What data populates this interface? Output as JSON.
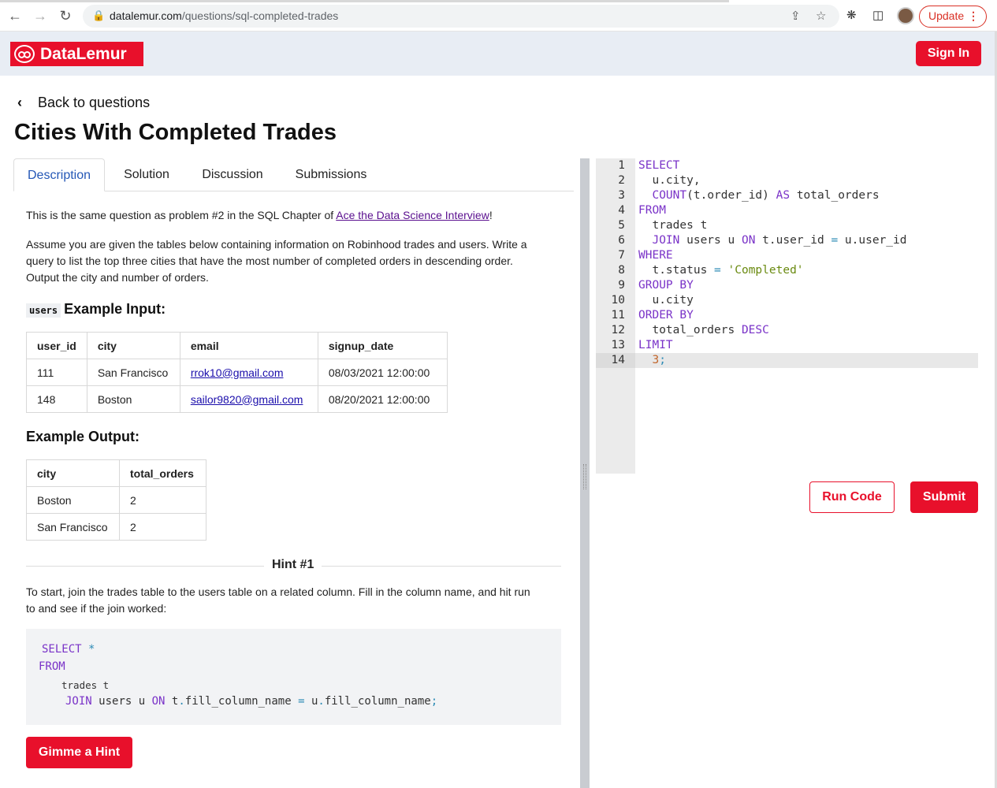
{
  "browser": {
    "url_domain": "datalemur.com",
    "url_path": "/questions/sql-completed-trades",
    "update_label": "Update"
  },
  "header": {
    "logo_text": "DataLemur",
    "signin_label": "Sign In"
  },
  "page": {
    "back_label": "Back to questions",
    "title": "Cities With Completed Trades"
  },
  "tabs": [
    "Description",
    "Solution",
    "Discussion",
    "Submissions"
  ],
  "description": {
    "intro_prefix": "This is the same question as problem #2 in the SQL Chapter of ",
    "intro_link": "Ace the Data Science Interview",
    "intro_suffix": "!",
    "body_line1": "Assume you are given the tables below containing information on Robinhood trades and users. Write a",
    "body_line2": "query to list the top three cities that have the most number of completed orders in descending order.",
    "body_line3": "Output the city and number of orders."
  },
  "input_table": {
    "table_tag": "users",
    "heading": "Example Input:",
    "columns": [
      "user_id",
      "city",
      "email",
      "signup_date"
    ],
    "rows": [
      [
        "111",
        "San Francisco",
        "rrok10@gmail.com",
        "08/03/2021 12:00:00"
      ],
      [
        "148",
        "Boston",
        "sailor9820@gmail.com",
        "08/20/2021 12:00:00"
      ]
    ]
  },
  "output_table": {
    "heading": "Example Output:",
    "columns": [
      "city",
      "total_orders"
    ],
    "rows": [
      [
        "Boston",
        "2"
      ],
      [
        "San Francisco",
        "2"
      ]
    ]
  },
  "hint": {
    "title": "Hint #1",
    "line1": "To start, join the trades table to the users table on a related column. Fill in the column name, and hit run",
    "line2": "to and see if the join worked:",
    "code": {
      "l1_kw": "SELECT",
      "l1_op": "*",
      "l2_kw": "FROM",
      "l3": "trades t",
      "l4_kw1": "JOIN",
      "l4_a": "users u",
      "l4_kw2": "ON",
      "l4_b": "t",
      "l4_dot1": ".",
      "l4_c": "fill_column_name",
      "l4_eq": "=",
      "l4_d": "u",
      "l4_dot2": ".",
      "l4_e": "fill_column_name",
      "l4_semi": ";"
    },
    "button_label": "Gimme a Hint"
  },
  "editor": {
    "lines": [
      {
        "n": "1",
        "parts": [
          [
            "kw",
            "SELECT"
          ]
        ]
      },
      {
        "n": "2",
        "parts": [
          [
            "plain",
            "  u.city,"
          ]
        ]
      },
      {
        "n": "3",
        "parts": [
          [
            "plain",
            "  "
          ],
          [
            "kw",
            "COUNT"
          ],
          [
            "plain",
            "(t.order_id) "
          ],
          [
            "kw",
            "AS"
          ],
          [
            "plain",
            " total_orders"
          ]
        ]
      },
      {
        "n": "4",
        "parts": [
          [
            "kw",
            "FROM"
          ]
        ]
      },
      {
        "n": "5",
        "parts": [
          [
            "plain",
            "  trades t"
          ]
        ]
      },
      {
        "n": "6",
        "parts": [
          [
            "plain",
            "  "
          ],
          [
            "kw",
            "JOIN"
          ],
          [
            "plain",
            " users u "
          ],
          [
            "kw",
            "ON"
          ],
          [
            "plain",
            " t.user_id "
          ],
          [
            "op",
            "="
          ],
          [
            "plain",
            " u.user_id"
          ]
        ]
      },
      {
        "n": "7",
        "parts": [
          [
            "kw",
            "WHERE"
          ]
        ]
      },
      {
        "n": "8",
        "parts": [
          [
            "plain",
            "  t.status "
          ],
          [
            "op",
            "="
          ],
          [
            "plain",
            " "
          ],
          [
            "str",
            "'Completed'"
          ]
        ]
      },
      {
        "n": "9",
        "parts": [
          [
            "kw",
            "GROUP BY"
          ]
        ]
      },
      {
        "n": "10",
        "parts": [
          [
            "plain",
            "  u.city"
          ]
        ]
      },
      {
        "n": "11",
        "parts": [
          [
            "kw",
            "ORDER BY"
          ]
        ]
      },
      {
        "n": "12",
        "parts": [
          [
            "plain",
            "  total_orders "
          ],
          [
            "kw",
            "DESC"
          ]
        ]
      },
      {
        "n": "13",
        "parts": [
          [
            "kw",
            "LIMIT"
          ]
        ]
      },
      {
        "n": "14",
        "parts": [
          [
            "plain",
            "  "
          ],
          [
            "num",
            "3"
          ],
          [
            "op",
            ";"
          ]
        ]
      }
    ],
    "current_line": 14,
    "run_label": "Run Code",
    "submit_label": "Submit"
  },
  "colors": {
    "brand_red": "#e8102b",
    "keyword_purple": "#7a33c8",
    "string_green": "#6a8a10",
    "active_tab_blue": "#2457b6"
  }
}
